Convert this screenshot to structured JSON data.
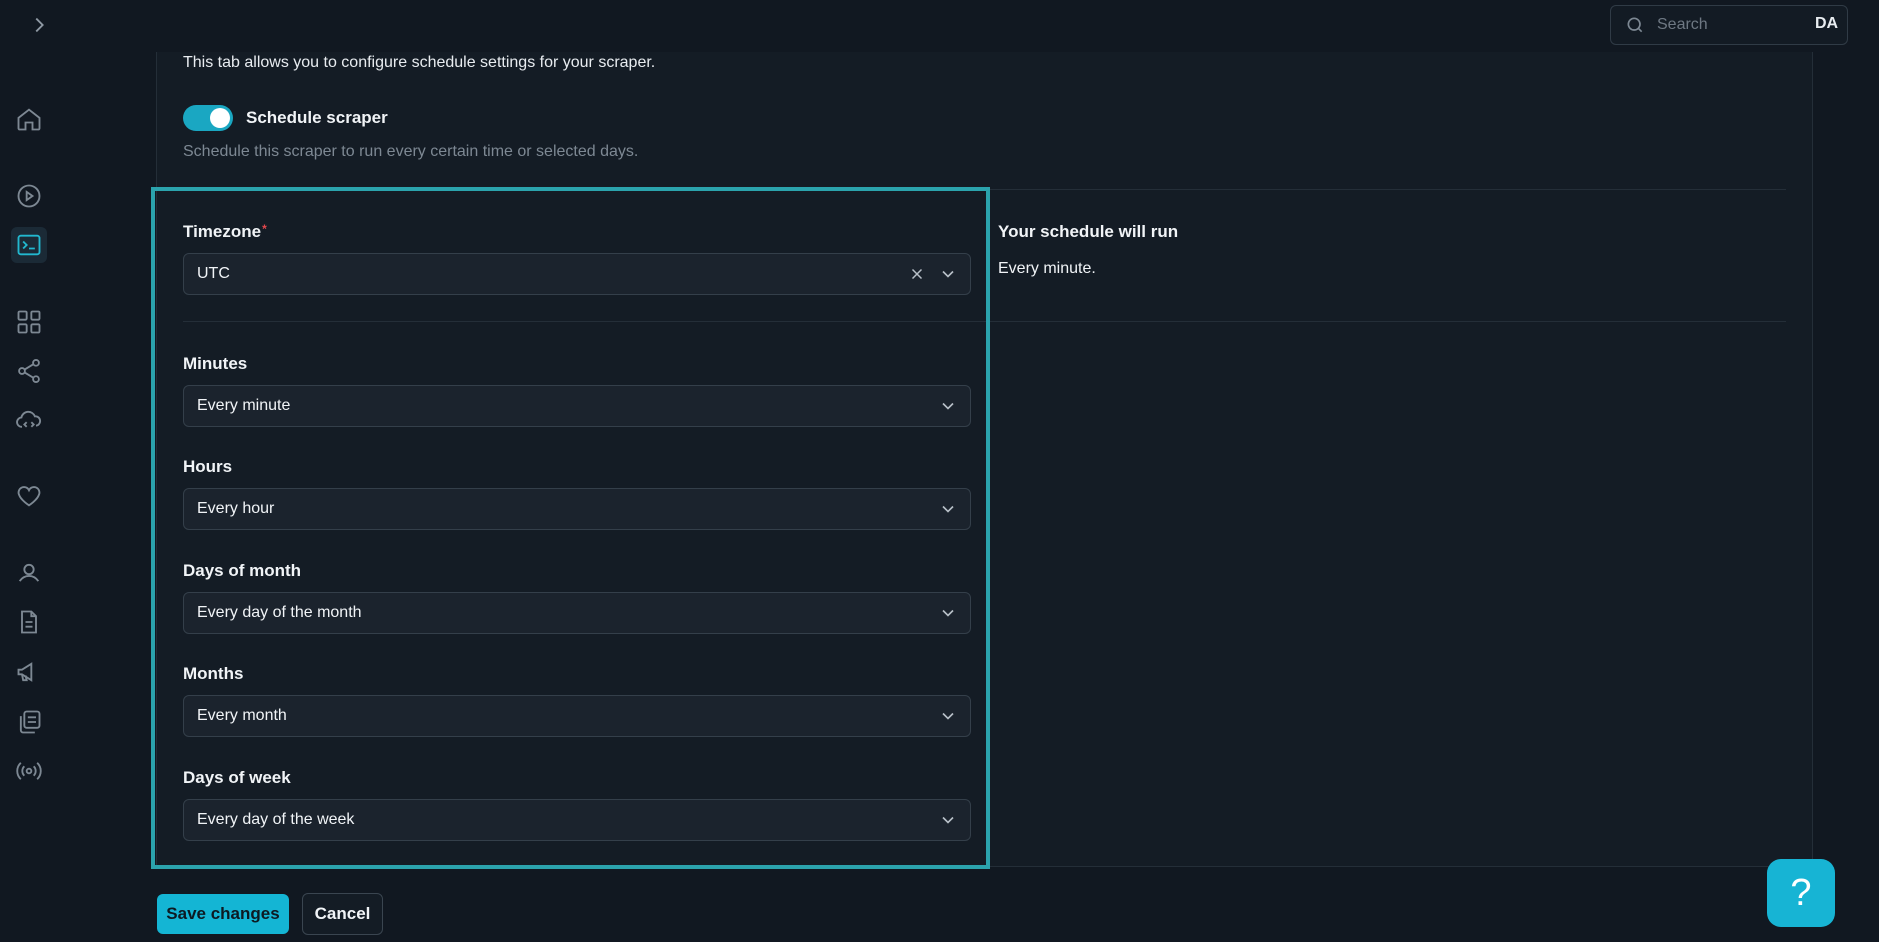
{
  "topbar": {
    "search_placeholder": "Search",
    "avatar_initials": "DA"
  },
  "sidebar": {
    "icons": [
      "chevron-right-icon",
      "home-icon",
      "play-circle-icon",
      "terminal-icon",
      "grid-icon",
      "share-icon",
      "cloud-code-icon",
      "heart-icon",
      "user-icon",
      "document-icon",
      "megaphone-icon",
      "copy-icon",
      "broadcast-icon"
    ],
    "active": "terminal-icon"
  },
  "schedule": {
    "intro": "This tab allows you to configure schedule settings for your scraper.",
    "toggle_label": "Schedule scraper",
    "toggle_on": true,
    "toggle_description": "Schedule this scraper to run every certain time or selected days."
  },
  "form": {
    "timezone": {
      "label": "Timezone",
      "required_mark": "*",
      "value": "UTC"
    },
    "minutes": {
      "label": "Minutes",
      "value": "Every minute"
    },
    "hours": {
      "label": "Hours",
      "value": "Every hour"
    },
    "days_of_month": {
      "label": "Days of month",
      "value": "Every day of the month"
    },
    "months": {
      "label": "Months",
      "value": "Every month"
    },
    "days_of_week": {
      "label": "Days of week",
      "value": "Every day of the week"
    }
  },
  "summary": {
    "title": "Your schedule will run",
    "text": "Every minute."
  },
  "actions": {
    "save_label": "Save changes",
    "cancel_label": "Cancel"
  },
  "help": {
    "label": "?"
  },
  "colors": {
    "background": "#111821",
    "accent": "#14b5d4",
    "highlight_border": "#2ba3ad"
  }
}
